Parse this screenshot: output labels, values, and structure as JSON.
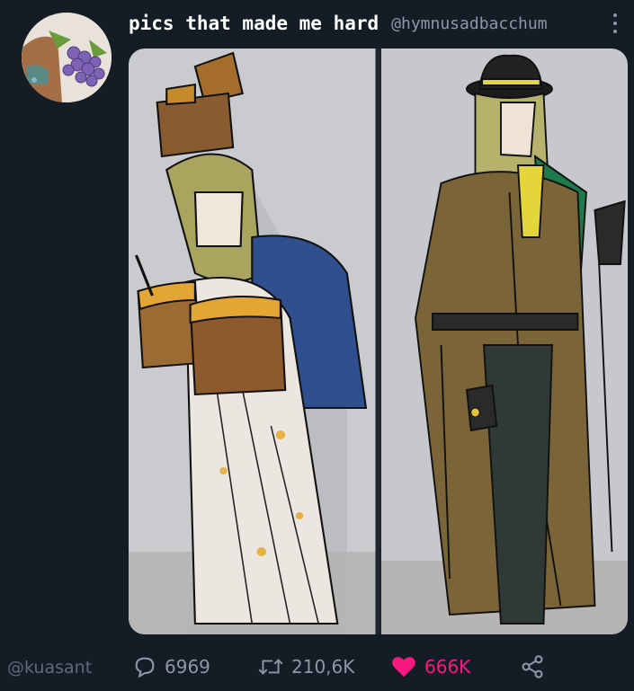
{
  "tweet": {
    "display_name": "pics that made me hard",
    "handle": "@hymnusadbacchum"
  },
  "media": {
    "panels": [
      "left-illustration",
      "right-illustration"
    ]
  },
  "actions": {
    "replies": "6969",
    "retweets": "210,6K",
    "likes": "666K",
    "liked": true,
    "like_color": "#f91880"
  },
  "watermark": "@kuasant",
  "icons": [
    "reply-icon",
    "retweet-icon",
    "heart-icon",
    "share-icon",
    "more-icon"
  ]
}
